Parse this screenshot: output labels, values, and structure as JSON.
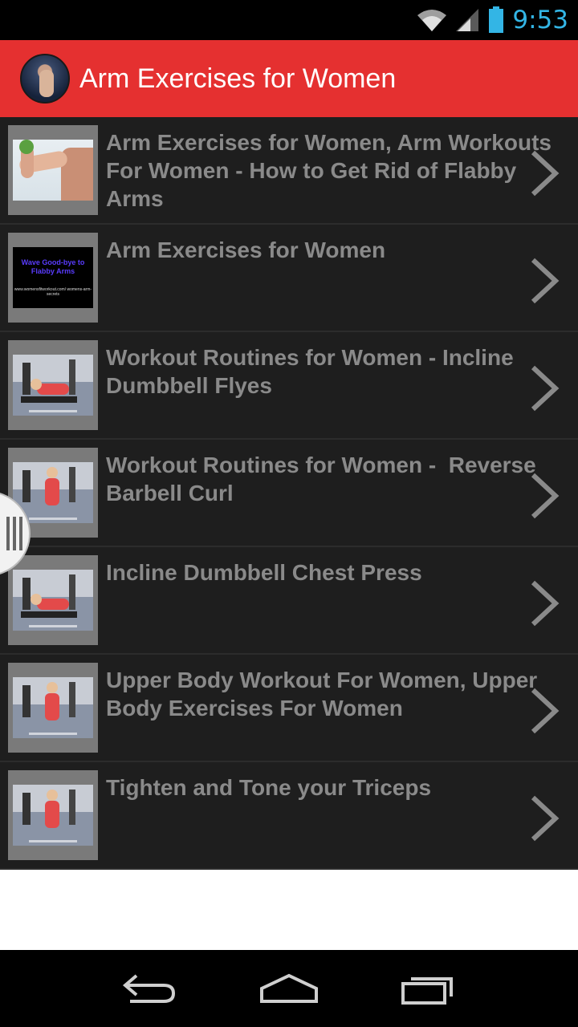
{
  "status_bar": {
    "time": "9:53",
    "icons": [
      "wifi-icon",
      "signal-icon",
      "battery-icon"
    ],
    "time_color": "#33b5e5"
  },
  "action_bar": {
    "title": "Arm Exercises for Women",
    "icon": "app-logo-icon",
    "background": "#e53030"
  },
  "list": {
    "items": [
      {
        "title": "Arm Exercises for Women, Arm Workouts For Women - How to Get Rid of Flabby Arms",
        "thumb": "arm-thumbnail"
      },
      {
        "title": "Arm Exercises for Women",
        "thumb": "text-thumbnail",
        "thumb_line1": "Wave Good-bye to Flabby Arms",
        "thumb_line2": "www.womensfitworkout.com/ womens-arm-secrets"
      },
      {
        "title": "Workout Routines for Women - Incline Dumbbell Flyes",
        "thumb": "gym-thumbnail"
      },
      {
        "title": "Workout Routines for Women -  Reverse Barbell Curl",
        "thumb": "gym-thumbnail"
      },
      {
        "title": "Incline Dumbbell Chest Press",
        "thumb": "gym-thumbnail"
      },
      {
        "title": "Upper Body Workout For Women, Upper Body Exercises For Women",
        "thumb": "gym-thumbnail"
      },
      {
        "title": "Tighten and Tone your Triceps",
        "thumb": "gym-thumbnail"
      }
    ],
    "chevron_icon": "chevron-right-icon"
  },
  "nav_bar": {
    "buttons": [
      "back-icon",
      "home-icon",
      "recent-apps-icon"
    ]
  }
}
